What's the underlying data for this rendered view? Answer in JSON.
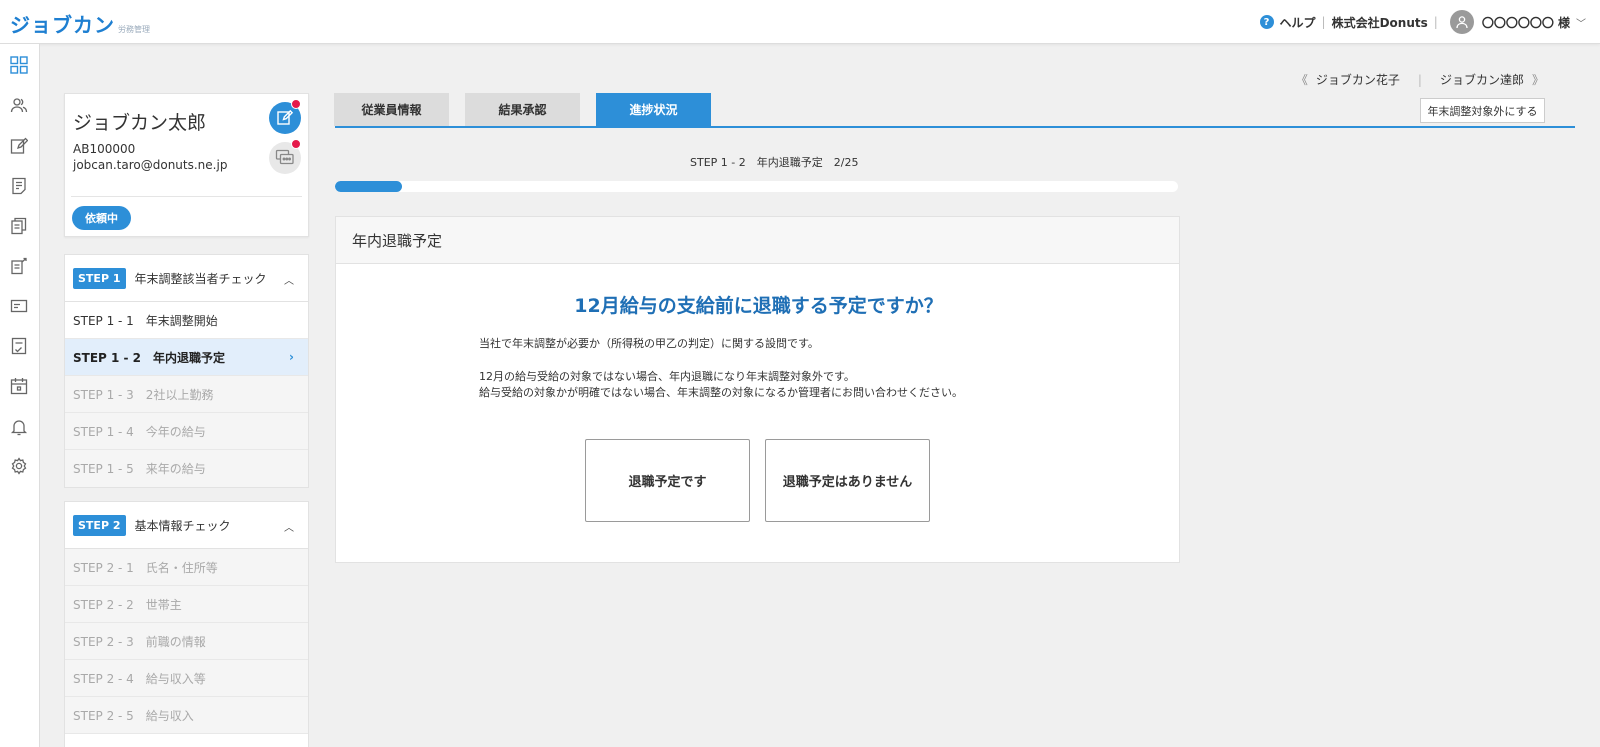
{
  "header": {
    "logo_main": "ジョブカン",
    "logo_sub": "労務管理",
    "help_label": "ヘルプ",
    "company": "株式会社Donuts",
    "user_name": "〇〇〇〇〇〇 様"
  },
  "rail": {
    "icons": [
      "dashboard-icon",
      "users-icon",
      "edit-icon",
      "document-icon",
      "documents-icon",
      "export-document-icon",
      "id-card-icon",
      "checklist-icon",
      "calendar-icon",
      "bell-icon",
      "settings-icon"
    ]
  },
  "employee": {
    "name": "ジョブカン太郎",
    "id": "AB100000",
    "email": "jobcan.taro@donuts.ne.jp",
    "status": "依頼中"
  },
  "nav": {
    "prev_label": "ジョブカン花子",
    "next_label": "ジョブカン達郎",
    "exclude_button": "年末調整対象外にする"
  },
  "tabs": [
    {
      "label": "従業員情報"
    },
    {
      "label": "結果承認"
    },
    {
      "label": "進捗状況"
    }
  ],
  "steps": [
    {
      "tag": "STEP 1",
      "title": "年末調整該当者チェック",
      "items": [
        {
          "label": "STEP 1 - 1　年末調整開始",
          "state": "done"
        },
        {
          "label": "STEP 1 - 2　年内退職予定",
          "state": "active"
        },
        {
          "label": "STEP 1 - 3　2社以上勤務",
          "state": "todo"
        },
        {
          "label": "STEP 1 - 4　今年の給与",
          "state": "todo"
        },
        {
          "label": "STEP 1 - 5　来年の給与",
          "state": "todo"
        }
      ]
    },
    {
      "tag": "STEP 2",
      "title": "基本情報チェック",
      "items": [
        {
          "label": "STEP 2 - 1　氏名・住所等",
          "state": "todo"
        },
        {
          "label": "STEP 2 - 2　世帯主",
          "state": "todo"
        },
        {
          "label": "STEP 2 - 3　前職の情報",
          "state": "todo"
        },
        {
          "label": "STEP 2 - 4　給与収入等",
          "state": "todo"
        },
        {
          "label": "STEP 2 - 5　給与収入",
          "state": "todo"
        }
      ]
    }
  ],
  "progress": {
    "label": "STEP 1 - 2　年内退職予定　2/25",
    "fraction": 0.08
  },
  "question": {
    "header": "年内退職予定",
    "title": "12月給与の支給前に退職する予定ですか？",
    "text1": "当社で年末調整が必要か（所得税の甲乙の判定）に関する設問です。",
    "text2": "12月の給与受給の対象ではない場合、年内退職になり年末調整対象外です。",
    "text3": "給与受給の対象かが明確ではない場合、年末調整の対象になるか管理者にお問い合わせください。",
    "choice_yes": "退職予定です",
    "choice_no": "退職予定はありません"
  },
  "colors": {
    "accent": "#2d8fd8",
    "title_blue": "#1f6fb5",
    "alert_dot": "#e5194a"
  }
}
